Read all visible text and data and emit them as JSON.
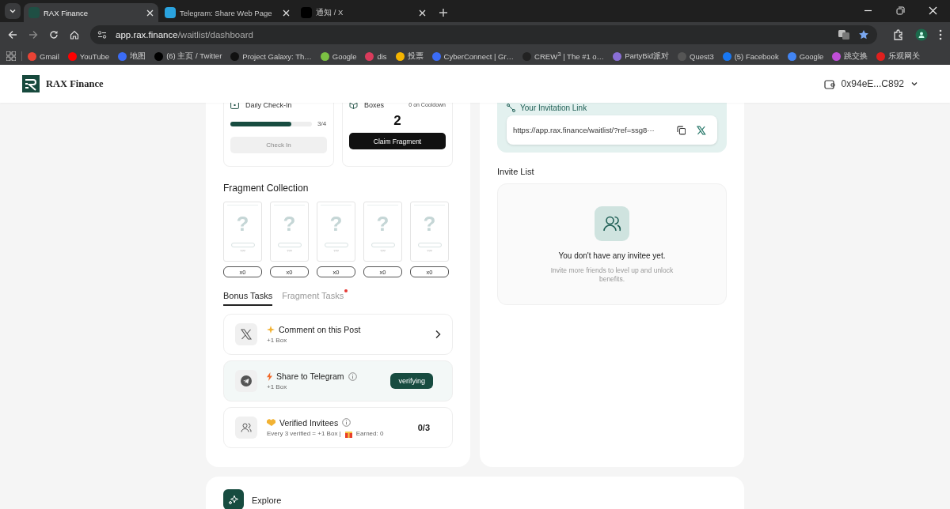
{
  "browser": {
    "tabs": [
      {
        "title": "RAX Finance",
        "selected": true,
        "color": "#1f4f44"
      },
      {
        "title": "Telegram: Share Web Page",
        "selected": false,
        "color": "#2aa3df"
      },
      {
        "title": "通知 / X",
        "selected": false,
        "color": "#000000"
      }
    ],
    "url_host": "app.rax.finance",
    "url_path": "/waitlist/dashboard",
    "bookmarks": [
      {
        "label": "Gmail",
        "color": "#ea4335"
      },
      {
        "label": "YouTube",
        "color": "#ff0000"
      },
      {
        "label": "地图",
        "color": "#3b6cf6"
      },
      {
        "label": "(6) 主页 / Twitter",
        "color": "#000000"
      },
      {
        "label": "Project Galaxy: Th…",
        "color": "#111111"
      },
      {
        "label": "Google",
        "color": "#7bc043"
      },
      {
        "label": "dis",
        "color": "#d93b5c"
      },
      {
        "label": "投票",
        "color": "#f5b400"
      },
      {
        "label": "CyberConnect | Gr…",
        "color": "#3b6cf6"
      },
      {
        "label": "CREW$^{3}$ | The #1 o…",
        "color": "#222222"
      },
      {
        "label": "PartyBid派对",
        "color": "#8a6fd6"
      },
      {
        "label": "Quest3",
        "color": "#555555"
      },
      {
        "label": "(5) Facebook",
        "color": "#1877f2"
      },
      {
        "label": "Google",
        "color": "#4285f4"
      },
      {
        "label": "跳交换",
        "color": "#c04fd8"
      },
      {
        "label": "乐观网关",
        "color": "#e0201e"
      }
    ]
  },
  "header": {
    "brand": "RAX Finance",
    "wallet": "0x94eE...C892"
  },
  "check_in": {
    "title": "Daily Check-In",
    "level": 0.75,
    "progress": "3/4",
    "button": "Check In",
    "disabled": true
  },
  "boxes": {
    "title": "Boxes",
    "cooldown": "0 on Cooldown",
    "count": "2",
    "button": "Claim Fragment"
  },
  "fragment_collection": {
    "title": "Fragment Collection",
    "items": [
      {
        "symbol": "?",
        "caption": "???",
        "count": "x0"
      },
      {
        "symbol": "?",
        "caption": "???",
        "count": "x0"
      },
      {
        "symbol": "?",
        "caption": "???",
        "count": "x0"
      },
      {
        "symbol": "?",
        "caption": "???",
        "count": "x0"
      },
      {
        "symbol": "?",
        "caption": "???",
        "count": "x0"
      }
    ]
  },
  "task_tabs": [
    {
      "label": "Bonus Tasks",
      "selected": true,
      "notification": false
    },
    {
      "label": "Fragment Tasks",
      "selected": false,
      "notification": true
    }
  ],
  "tasks": [
    {
      "kind": "link",
      "title": "Comment on this Post",
      "subtitle": "+1 Box",
      "info": false,
      "highlighted": false
    },
    {
      "kind": "verify",
      "title": "Share to Telegram",
      "subtitle": "+1 Box",
      "info": true,
      "highlighted": true,
      "button": "verifying"
    },
    {
      "kind": "progress",
      "title": "Verified Invitees",
      "subtitle": "Every 3 verified = +1 Box |",
      "earned": "Earned: 0",
      "info": true,
      "highlighted": false,
      "progress": "0/3"
    }
  ],
  "invitation": {
    "title": "Your Invitation Link",
    "link": "https://app.rax.finance/waitlist/?ref=ssg8···"
  },
  "invite_list": {
    "title": "Invite List",
    "empty_title": "You don't have any invitee yet.",
    "empty_text": "Invite more friends to level up and unlock benefits."
  },
  "explore": {
    "title": "Explore"
  }
}
